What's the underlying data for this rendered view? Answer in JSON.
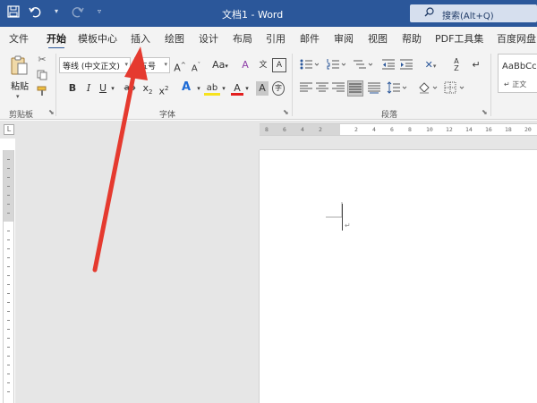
{
  "window": {
    "title": "文档1 - Word",
    "search_placeholder": "搜索(Alt+Q)"
  },
  "quick_access": {
    "save_icon": "save-icon",
    "undo_icon": "undo-icon",
    "redo_icon": "redo-icon",
    "customize_icon": "customize-qat-icon"
  },
  "tabs": [
    {
      "label": "文件"
    },
    {
      "label": "开始"
    },
    {
      "label": "模板中心"
    },
    {
      "label": "插入"
    },
    {
      "label": "绘图"
    },
    {
      "label": "设计"
    },
    {
      "label": "布局"
    },
    {
      "label": "引用"
    },
    {
      "label": "邮件"
    },
    {
      "label": "审阅"
    },
    {
      "label": "视图"
    },
    {
      "label": "帮助"
    },
    {
      "label": "PDF工具集"
    },
    {
      "label": "百度网盘"
    }
  ],
  "active_tab": "开始",
  "clipboard": {
    "paste_label": "粘贴",
    "group_label": "剪贴板"
  },
  "font": {
    "font_name": "等线 (中文正文)",
    "font_size": "五号",
    "grow_label": "A",
    "shrink_label": "A",
    "case_label": "Aa",
    "bold": "B",
    "italic": "I",
    "underline": "U",
    "strike": "ab",
    "subscript": "x",
    "superscript": "x",
    "text_effects": "A",
    "highlight": "ab",
    "font_color": "A",
    "char_shading": "A",
    "enclose": "字",
    "phonetic": "文",
    "border": "A",
    "group_label": "字体"
  },
  "paragraph": {
    "group_label": "段落"
  },
  "styles": {
    "sample": "AaBbCcDd",
    "name": "↵ 正文"
  },
  "ruler": {
    "corner": "L",
    "labels": [
      "8",
      "6",
      "4",
      "2",
      "2",
      "4",
      "6",
      "8",
      "10",
      "12",
      "14",
      "16",
      "18",
      "20"
    ]
  },
  "colors": {
    "titlebar": "#2b579a",
    "ribbon_bg": "#f3f3f3",
    "canvas_bg": "#e6e6e6",
    "annotation_arrow": "#e53a2f"
  },
  "document": {
    "paragraph_mark": "↵"
  }
}
